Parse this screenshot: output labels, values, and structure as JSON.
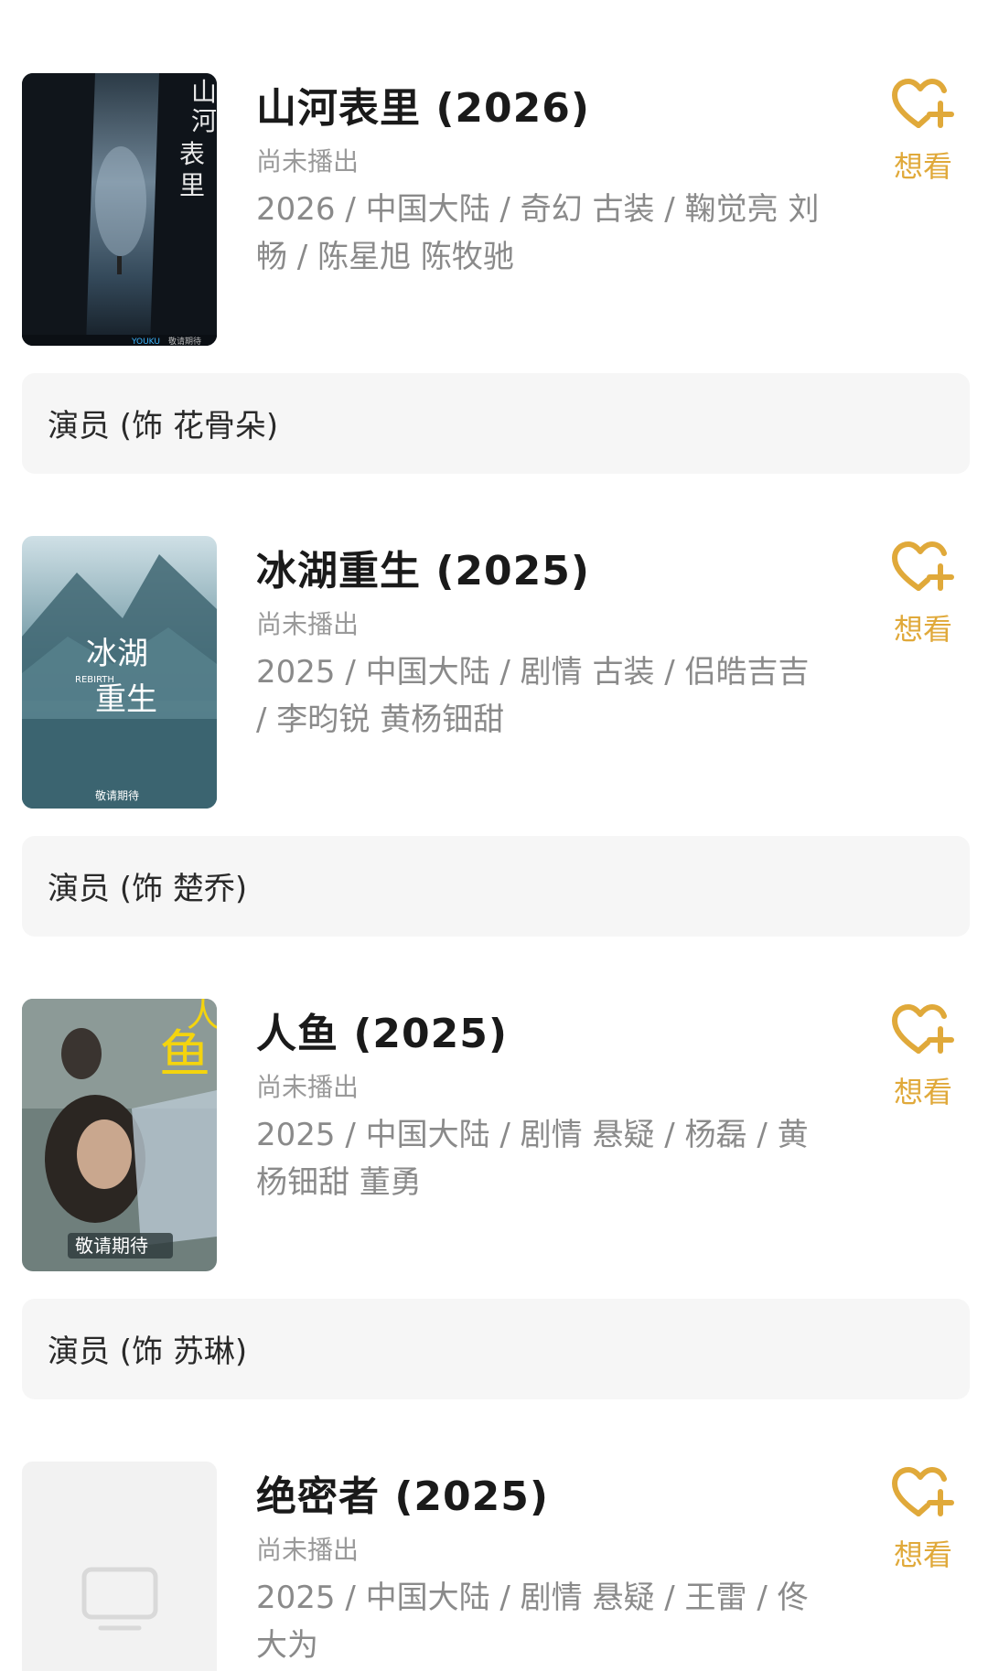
{
  "items": [
    {
      "title": "山河表里 (2026)",
      "status": "尚未播出",
      "meta": "2026 / 中国大陆 / 奇幻 古装 / 鞠觉亮 刘畅 / 陈星旭 陈牧驰",
      "want_label": "想看",
      "role": "演员 (饰 花骨朵)",
      "poster": {
        "calligraphy": "山河表里",
        "footer_left": "YOUKU",
        "footer_right": "敬请期待"
      }
    },
    {
      "title": "冰湖重生 (2025)",
      "status": "尚未播出",
      "meta": "2025 / 中国大陆 / 剧情 古装 / 侣皓吉吉 / 李昀锐 黄杨钿甜",
      "want_label": "想看",
      "role": "演员 (饰 楚乔)",
      "poster": {
        "calligraphy": "冰湖重生",
        "english": "REBIRTH",
        "footer": "敬请期待"
      }
    },
    {
      "title": "人鱼 (2025)",
      "status": "尚未播出",
      "meta": "2025 / 中国大陆 / 剧情 悬疑 / 杨磊 / 黄杨钿甜 董勇",
      "want_label": "想看",
      "role": "演员 (饰 苏琳)",
      "poster": {
        "calligraphy": "人鱼",
        "footer": "敬请期待"
      }
    },
    {
      "title": "绝密者 (2025)",
      "status": "尚未播出",
      "meta": "2025 / 中国大陆 / 剧情 悬疑 / 王雷 / 佟大为",
      "want_label": "想看"
    }
  ],
  "colors": {
    "accent": "#e0a93a",
    "title": "#1a1a1a",
    "meta": "#8a8a8a",
    "role_bg": "#f6f6f6"
  },
  "icons": {
    "want": "heart-plus-icon",
    "placeholder": "tv-icon"
  }
}
